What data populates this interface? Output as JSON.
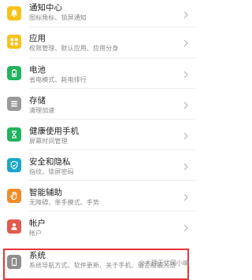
{
  "settings": {
    "items": [
      {
        "key": "notifications",
        "title": "通知中心",
        "subtitle": "图标角标、锁屏通知",
        "icon": "bell-icon",
        "color": "#f7c21b"
      },
      {
        "key": "apps",
        "title": "应用",
        "subtitle": "权限管理、默认应用、应用分身",
        "icon": "apps-grid-icon",
        "color": "#f7c21b"
      },
      {
        "key": "battery",
        "title": "电池",
        "subtitle": "省电模式、耗电排行",
        "icon": "battery-icon",
        "color": "#21b35f"
      },
      {
        "key": "storage",
        "title": "存储",
        "subtitle": "清理加速",
        "icon": "storage-icon",
        "color": "#9a9a9a"
      },
      {
        "key": "digital_wellbeing",
        "title": "健康使用手机",
        "subtitle": "屏幕时间管理",
        "icon": "hourglass-icon",
        "color": "#21b35f"
      },
      {
        "key": "security",
        "title": "安全和隐私",
        "subtitle": "指纹、锁屏密码",
        "icon": "shield-icon",
        "color": "#1aa6c9"
      },
      {
        "key": "accessibility",
        "title": "智能辅助",
        "subtitle": "无障碍、单手模式、手势",
        "icon": "hand-icon",
        "color": "#f08b2a"
      },
      {
        "key": "accounts",
        "title": "帐户",
        "subtitle": "帐户",
        "icon": "person-icon",
        "color": "#e25a4c"
      },
      {
        "key": "system",
        "title": "系统",
        "subtitle": "系统导航方式、软件更新、关于手机、语言和输入法",
        "icon": "phone-icon",
        "color": "#8e8e8e"
      }
    ]
  },
  "watermark": "@大理无忧网小编"
}
